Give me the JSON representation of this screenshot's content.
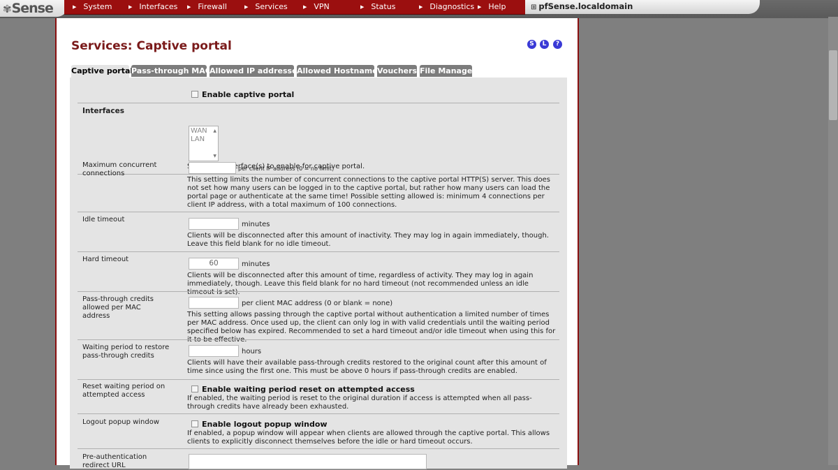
{
  "logo": {
    "text": "Sense"
  },
  "nav": {
    "items": [
      "System",
      "Interfaces",
      "Firewall",
      "Services",
      "VPN",
      "Status",
      "Diagnostics",
      "Help"
    ],
    "hostname": "pfSense.localdomain"
  },
  "page": {
    "title": "Services: Captive portal",
    "help_icons": [
      "S",
      "L",
      "?"
    ]
  },
  "tabs": [
    "Captive portal",
    "Pass-through MAC",
    "Allowed IP addresses",
    "Allowed Hostnames",
    "Vouchers",
    "File Manager"
  ],
  "form": {
    "enable_label": "Enable captive portal",
    "interfaces": {
      "label": "Interfaces",
      "options": [
        "WAN",
        "LAN"
      ],
      "desc": "Select the interface(s) to enable for captive portal."
    },
    "max_conn": {
      "label": "Maximum concurrent connections",
      "value": "",
      "unit": "per client IP address (0 = no limit)",
      "desc": "This setting limits the number of concurrent connections to the captive portal HTTP(S) server. This does not set how many users can be logged in to the captive portal, but rather how many users can load the portal page or authenticate at the same time! Possible setting allowed is: minimum 4 connections per client IP address, with a total maximum of 100 connections."
    },
    "idle_timeout": {
      "label": "Idle timeout",
      "value": "",
      "unit": "minutes",
      "desc": "Clients will be disconnected after this amount of inactivity. They may log in again immediately, though. Leave this field blank for no idle timeout."
    },
    "hard_timeout": {
      "label": "Hard timeout",
      "value": "60",
      "unit": "minutes",
      "desc": "Clients will be disconnected after this amount of time, regardless of activity. They may log in again immediately, though. Leave this field blank for no hard timeout (not recommended unless an idle timeout is set)."
    },
    "passthrough_credits": {
      "label": "Pass-through credits allowed per MAC address",
      "value": "",
      "unit": "per client MAC address (0 or blank = none)",
      "desc": "This setting allows passing through the captive portal without authentication a limited number of times per MAC address. Once used up, the client can only log in with valid credentials until the waiting period specified below has expired. Recommended to set a hard timeout and/or idle timeout when using this for it to be effective."
    },
    "waiting_period": {
      "label": "Waiting period to restore pass-through credits",
      "value": "",
      "unit": "hours",
      "desc": "Clients will have their available pass-through credits restored to the original count after this amount of time since using the first one. This must be above 0 hours if pass-through credits are enabled."
    },
    "reset_waiting": {
      "label": "Reset waiting period on attempted access",
      "check_label": "Enable waiting period reset on attempted access",
      "desc": "If enabled, the waiting period is reset to the original duration if access is attempted when all pass-through credits have already been exhausted."
    },
    "logout_popup": {
      "label": "Logout popup window",
      "check_label": "Enable logout popup window",
      "desc": "If enabled, a popup window will appear when clients are allowed through the captive portal. This allows clients to explicitly disconnect themselves before the idle or hard timeout occurs."
    },
    "preauth": {
      "label": "Pre-authentication redirect URL",
      "value": ""
    }
  },
  "colors": {
    "accent": "#9b0f0f",
    "title": "#7a1a1a",
    "tab": "#7c7c7c"
  },
  "icons": [
    "pfsense-logo-icon",
    "menu-arrow-icon",
    "host-icon",
    "scroll-up-icon",
    "scroll-down-icon",
    "checkbox-icon"
  ]
}
